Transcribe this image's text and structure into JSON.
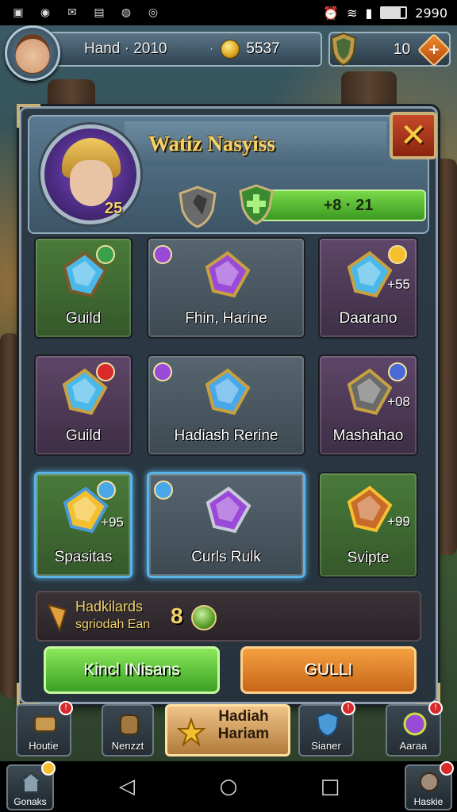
{
  "status_bar": {
    "time": "2990",
    "left_icons": [
      "photo-icon",
      "record-icon",
      "mail-icon",
      "gallery-icon",
      "message-icon",
      "game-icon"
    ]
  },
  "hud": {
    "player_name": "Hand · 2010",
    "coin_prefix": "·",
    "coins": "5537",
    "gems": "10",
    "plus_label": "+"
  },
  "panel": {
    "title": "Watiz Nasyiss",
    "close_label": "✕",
    "hero_level": "25",
    "xp_text": "+8 · 21"
  },
  "items": [
    {
      "label": "Guild",
      "count": "",
      "color": "green"
    },
    {
      "label": "Fhin, Harine",
      "count": "",
      "color": "grey"
    },
    {
      "label": "Daarano",
      "count": "+55",
      "color": "purple"
    },
    {
      "label": "Guild",
      "count": "",
      "color": "purple"
    },
    {
      "label": "Hadiash Rerine",
      "count": "",
      "color": "grey"
    },
    {
      "label": "Mashahao",
      "count": "+08",
      "color": "purple"
    },
    {
      "label": "Spasitas",
      "count": "+95",
      "color": "green"
    },
    {
      "label": "Curls Rulk",
      "count": "",
      "color": "grey"
    },
    {
      "label": "Svipte",
      "count": "+99",
      "color": "green"
    }
  ],
  "reward": {
    "line1": "Hadkilards",
    "line2": "sgriodah Ean",
    "amount": "8"
  },
  "buttons": {
    "left": "Kincl INisans",
    "right": "GULLI"
  },
  "tabs": [
    {
      "label": "Houtie",
      "badge": "!"
    },
    {
      "label": "Nenzzt",
      "badge": ""
    },
    {
      "label": "Hadiah Hariam",
      "badge": ""
    },
    {
      "label": "Sianer",
      "badge": "!"
    },
    {
      "label": "Aaraa",
      "badge": "!"
    }
  ],
  "navbar": {
    "left_corner": "Gonaks",
    "right_corner": "Haskie",
    "back": "◁",
    "home": "○",
    "recent": "□"
  },
  "colors": {
    "gold": "#f4d36a",
    "xp_green": "#5ab43a",
    "selected_border": "#5ab4e8"
  }
}
